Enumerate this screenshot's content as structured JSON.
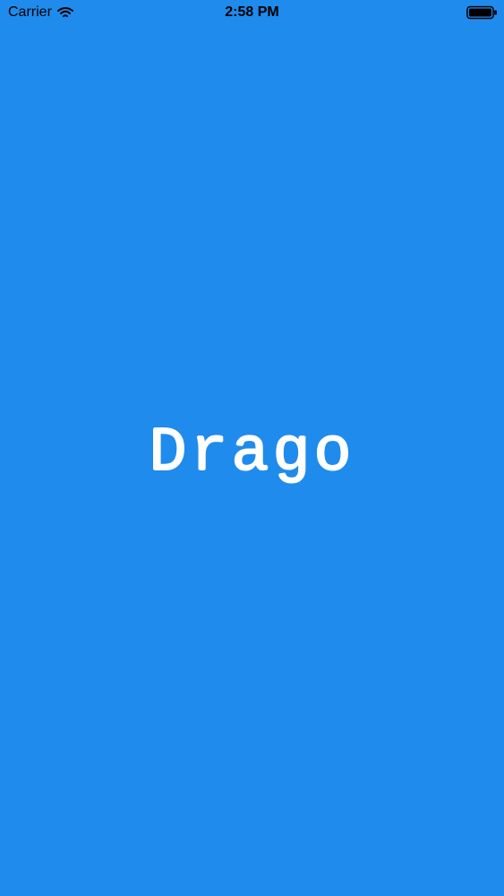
{
  "status_bar": {
    "carrier": "Carrier",
    "time": "2:58 PM",
    "icons": {
      "wifi": "wifi-icon",
      "battery": "battery-icon"
    }
  },
  "splash": {
    "title": "Drago"
  },
  "colors": {
    "background": "#1f8bed",
    "status_text": "#000000",
    "title": "#ffffff"
  }
}
